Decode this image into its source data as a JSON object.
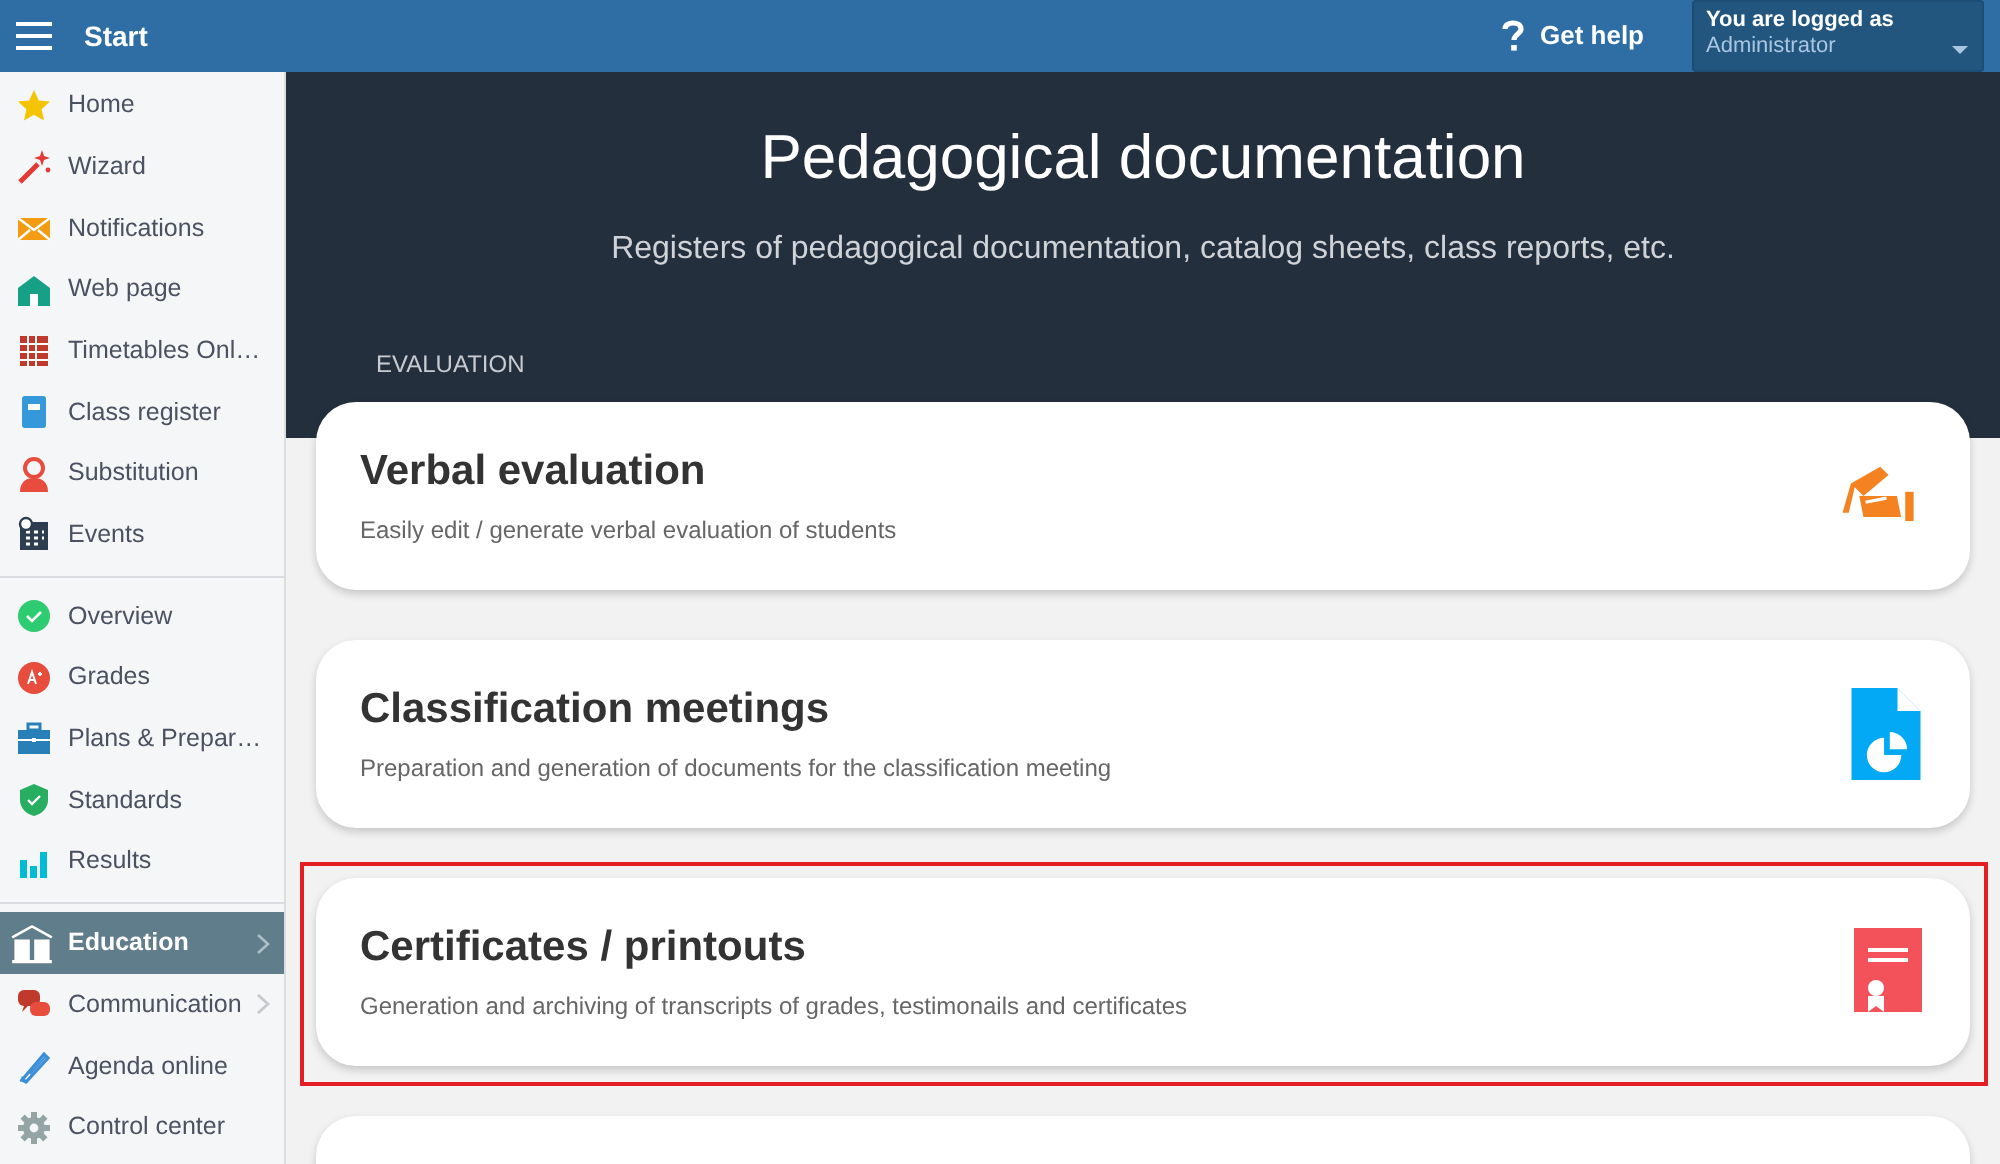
{
  "header": {
    "title": "Start",
    "help": "Get help",
    "user_label": "You are logged as",
    "user": "Administrator"
  },
  "sidebar": {
    "groups": [
      [
        {
          "label": "Home",
          "selected": false,
          "submenu": false
        },
        {
          "label": "Wizard",
          "selected": false,
          "submenu": false
        },
        {
          "label": "Notifications",
          "selected": false,
          "submenu": false
        },
        {
          "label": "Web page",
          "selected": false,
          "submenu": false
        },
        {
          "label": "Timetables Onl…",
          "selected": false,
          "submenu": false
        },
        {
          "label": "Class register",
          "selected": false,
          "submenu": false
        },
        {
          "label": "Substitution",
          "selected": false,
          "submenu": false
        },
        {
          "label": "Events",
          "selected": false,
          "submenu": false
        }
      ],
      [
        {
          "label": "Overview",
          "selected": false,
          "submenu": false
        },
        {
          "label": "Grades",
          "selected": false,
          "submenu": false
        },
        {
          "label": "Plans & Prepar…",
          "selected": false,
          "submenu": false
        },
        {
          "label": "Standards",
          "selected": false,
          "submenu": false
        },
        {
          "label": "Results",
          "selected": false,
          "submenu": false
        }
      ],
      [
        {
          "label": "Education",
          "selected": true,
          "submenu": true
        },
        {
          "label": "Communication",
          "selected": false,
          "submenu": true
        },
        {
          "label": "Agenda online",
          "selected": false,
          "submenu": false
        },
        {
          "label": "Control center",
          "selected": false,
          "submenu": false
        }
      ]
    ]
  },
  "hero": {
    "title": "Pedagogical documentation",
    "subtitle": "Registers of pedagogical documentation, catalog sheets, class reports, etc.",
    "section": "EVALUATION"
  },
  "cards": [
    {
      "title": "Verbal evaluation",
      "description": "Easily edit / generate verbal evaluation of students",
      "highlighted": false
    },
    {
      "title": "Classification meetings",
      "description": "Preparation and generation of documents for the classification meeting",
      "highlighted": false
    },
    {
      "title": "Certificates / printouts",
      "description": "Generation and archiving of transcripts of grades, testimonails and certificates",
      "highlighted": true
    },
    {
      "highlighted": false
    }
  ]
}
